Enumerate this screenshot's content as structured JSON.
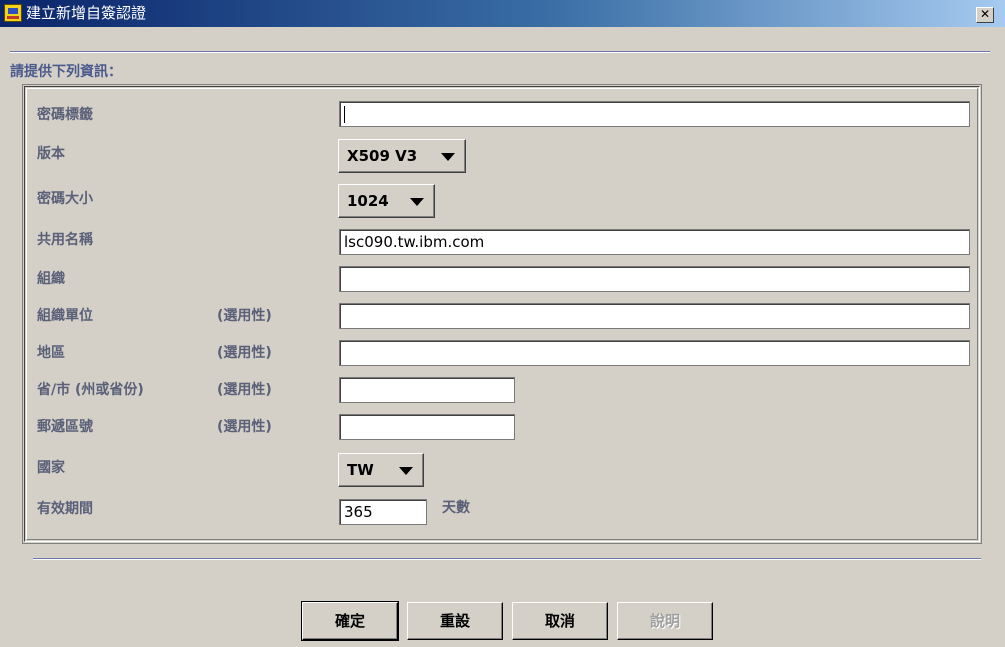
{
  "window": {
    "title": "建立新增自簽認證",
    "close_glyph": "✕"
  },
  "section_title": "請提供下列資訊：",
  "optional_tag": "(選用性)",
  "form": {
    "key_label": {
      "label": "密碼標籤",
      "value": ""
    },
    "version": {
      "label": "版本",
      "value": "X509 V3"
    },
    "key_size": {
      "label": "密碼大小",
      "value": "1024"
    },
    "common_name": {
      "label": "共用名稱",
      "value": "lsc090.tw.ibm.com"
    },
    "organization": {
      "label": "組織",
      "value": ""
    },
    "org_unit": {
      "label": "組織單位",
      "value": ""
    },
    "locality": {
      "label": "地區",
      "value": ""
    },
    "state": {
      "label": "省/市 (州或省份)",
      "value": ""
    },
    "zip": {
      "label": "郵遞區號",
      "value": ""
    },
    "country": {
      "label": "國家",
      "value": "TW"
    },
    "validity": {
      "label": "有效期間",
      "value": "365",
      "unit": "天數"
    }
  },
  "buttons": {
    "ok": "確定",
    "reset": "重設",
    "cancel": "取消",
    "help": "說明"
  },
  "icons": {
    "title_icon": "app-certificate-icon",
    "close_icon": "close-icon",
    "dropdown_icon": "triangle-down-icon"
  }
}
